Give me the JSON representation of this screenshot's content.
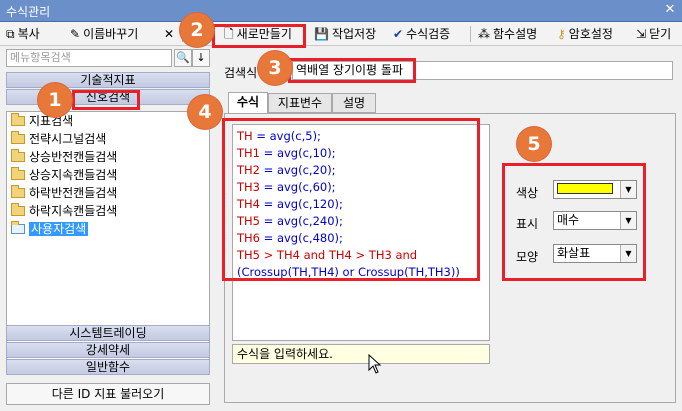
{
  "window": {
    "title": "수식관리",
    "close_glyph": "✕"
  },
  "toolbar": {
    "copy": "복사",
    "rename": "이름바꾸기",
    "delete_glyph": "✕",
    "new": "새로만들기",
    "save": "작업저장",
    "verify": "수식검증",
    "func_help": "함수설명",
    "password": "암호설정",
    "close": "닫기"
  },
  "left": {
    "search_placeholder": "메뉴항목검색",
    "search_btn_glyph": "🔍",
    "down_btn_glyph": "↓",
    "categories_top": [
      "기술적지표",
      "신호검색"
    ],
    "tree_items": [
      "지표검색",
      "전략시그널검색",
      "상승반전캔들검색",
      "상승지속캔들검색",
      "하락반전캔들검색",
      "하락지속캔들검색",
      "사용자검색"
    ],
    "selected_item": "사용자검색",
    "categories_bottom": [
      "시스템트레이딩",
      "강세약세",
      "일반함수"
    ],
    "load_button": "다른 ID 지표 불러오기"
  },
  "right": {
    "name_label": "검색식",
    "name_value": "역배열 장기이평 돌파",
    "tabs": [
      "수식",
      "지표변수",
      "설명"
    ],
    "active_tab": "수식",
    "code_lines": [
      {
        "lhs": "TH",
        "rhs": " = avg(c,5);"
      },
      {
        "lhs": "TH1",
        "rhs": " = avg(c,10);"
      },
      {
        "lhs": "TH2",
        "rhs": " = avg(c,20);"
      },
      {
        "lhs": "TH3",
        "rhs": " = avg(c,60);"
      },
      {
        "lhs": "TH4",
        "rhs": " = avg(c,120);"
      },
      {
        "lhs": "TH5",
        "rhs": " = avg(c,240);"
      },
      {
        "lhs": "TH6",
        "rhs": " = avg(c,480);"
      }
    ],
    "code_cond_1": "TH5 > TH4 and TH4 > TH3 and",
    "code_cond_2": "(Crossup(TH,TH4) or Crossup(TH,TH3))",
    "hint": "수식을 입력하세요.",
    "color_label": "색상",
    "color_value": "#ffff00",
    "display_label": "표시",
    "display_value": "매수",
    "shape_label": "모양",
    "shape_value": "화살표"
  },
  "annotations": [
    "1",
    "2",
    "3",
    "4",
    "5"
  ],
  "colors": {
    "annotation_border": "#e8202a",
    "badge": "#e8783a",
    "titlebar": "#6b8fc9",
    "selection": "#3399ff"
  }
}
